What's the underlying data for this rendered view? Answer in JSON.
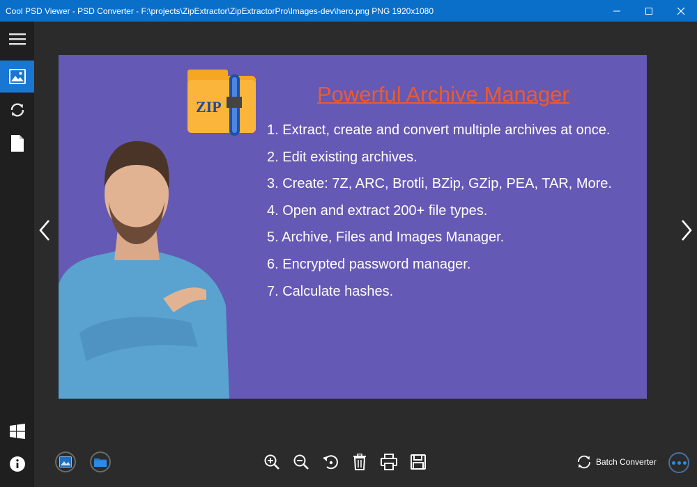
{
  "window": {
    "title": "Cool PSD Viewer - PSD Converter - F:\\projects\\ZipExtractor\\ZipExtractorPro\\Images-dev\\hero.png PNG 1920x1080",
    "controls": [
      "minimize-icon",
      "maximize-icon",
      "close-icon"
    ]
  },
  "sidebar": {
    "items": [
      {
        "icon": "hamburger-menu-icon"
      },
      {
        "icon": "image-icon",
        "active": true
      },
      {
        "icon": "convert-sync-icon"
      },
      {
        "icon": "document-icon"
      },
      {
        "icon": "windows-logo-icon"
      },
      {
        "icon": "info-icon"
      }
    ]
  },
  "image": {
    "logo_text": "ZIP",
    "headline": "Powerful Archive Manager",
    "features": [
      "1. Extract, create and convert multiple archives at once.",
      "2. Edit existing archives.",
      "3. Create: 7Z, ARC, Brotli, BZip, GZip, PEA, TAR, More.",
      "4. Open and extract 200+ file types.",
      "5. Archive, Files and Images Manager.",
      "6. Encrypted password manager.",
      "7. Calculate hashes."
    ]
  },
  "toolbar": {
    "left": [
      "set-wallpaper-icon",
      "open-folder-icon"
    ],
    "center": [
      "zoom-in-icon",
      "zoom-out-icon",
      "rotate-icon",
      "delete-icon",
      "print-icon",
      "save-icon"
    ],
    "batch_label": "Batch Converter"
  },
  "colors": {
    "titlebar": "#0a6fc9",
    "accent": "#1976d2",
    "image_bg": "#6459b4",
    "headline": "#ef5a2c"
  }
}
